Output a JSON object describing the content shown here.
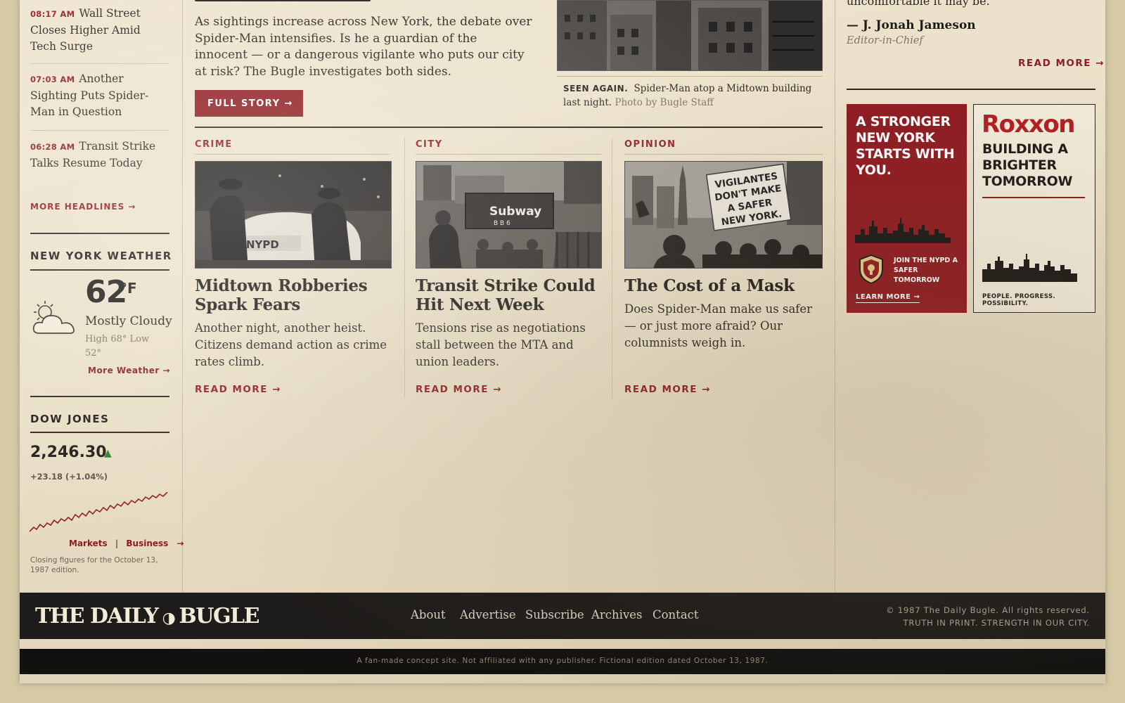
{
  "headlines": [
    {
      "time": "08:17 AM",
      "text": "Wall Street Closes Higher Amid Tech Surge"
    },
    {
      "time": "07:03 AM",
      "text": "Another Sighting Puts Spider-Man in Question"
    },
    {
      "time": "06:28 AM",
      "text": "Transit Strike Talks Resume Today"
    }
  ],
  "more_headlines": "MORE HEADLINES →",
  "weather": {
    "title": "NEW YORK WEATHER",
    "temp": "62",
    "unit": "°F",
    "condition": "Mostly Cloudy",
    "hilo": "High 68°   Low 52°",
    "more": "More Weather →",
    "icon": "partly-cloudy-icon"
  },
  "dow": {
    "title": "DOW JONES",
    "value": "2,246.30",
    "arrow": "▲",
    "change": "+23.18 (+1.04%)",
    "links": [
      "Markets",
      "|",
      "Business",
      "→"
    ],
    "footnote": "Closing figures for the October 13, 1987 edition."
  },
  "lede": {
    "text": "As sightings increase across New York, the debate over Spider-Man intensifies. Is he a guardian of the innocent — or a dangerous vigilante who puts our city at risk? The Bugle investigates both sides.",
    "button": "FULL STORY  →"
  },
  "hero_caption": {
    "label": "SEEN AGAIN.",
    "text": "Spider-Man atop a Midtown building last night.",
    "credit": "Photo by Bugle Staff"
  },
  "stories": [
    {
      "category": "CRIME",
      "title": "Midtown Robberies Spark Fears",
      "desc": "Another night, another heist. Citizens demand action as crime rates climb.",
      "more": "READ MORE  →"
    },
    {
      "category": "CITY",
      "title": "Transit Strike Could Hit Next Week",
      "desc": "Tensions rise as negotiations stall between the MTA and union leaders.",
      "more": "READ MORE  →"
    },
    {
      "category": "OPINION",
      "title": "The Cost of a Mask",
      "desc": "Does Spider-Man make us safer — or just more afraid? Our columnists weigh in.",
      "more": "READ MORE  →"
    }
  ],
  "image_text": {
    "nypd": "NYPD",
    "subway": "Subway",
    "subway_lines": "B  B  6",
    "sign": [
      "VIGILANTES",
      "DON'T MAKE",
      "A SAFER",
      "NEW YORK."
    ]
  },
  "editorial": {
    "tail": "uncomfortable it may be.",
    "signature": "— J. Jonah Jameson",
    "role": "Editor-in-Chief",
    "more": "READ MORE  →"
  },
  "ads": {
    "nypd": {
      "headline": "A STRONGER NEW YORK STARTS WITH YOU.",
      "join": "JOIN THE NYPD A SAFER TOMORROW",
      "learn": "LEARN MORE  →"
    },
    "roxxon": {
      "logo": "Roxxon",
      "headline": "BUILDING A BRIGHTER TOMORROW",
      "tagline": "PEOPLE. PROGRESS. POSSIBILITY."
    }
  },
  "footer": {
    "logo_left": "THE DAILY",
    "logo_right": "BUGLE",
    "nav": [
      "About",
      "Advertise",
      "Subscribe",
      "Archives",
      "Contact"
    ],
    "copyright": "© 1987 The Daily Bugle. All rights reserved.",
    "slogan": "TRUTH IN PRINT. STRENGTH IN OUR CITY.",
    "disclaimer": "A fan-made concept site. Not affiliated with any publisher. Fictional edition dated October 13, 1987."
  },
  "colors": {
    "accent": "#8f1c22",
    "paper": "#ebe1c9",
    "ink": "#1f1c18",
    "up": "#2f7d32"
  }
}
